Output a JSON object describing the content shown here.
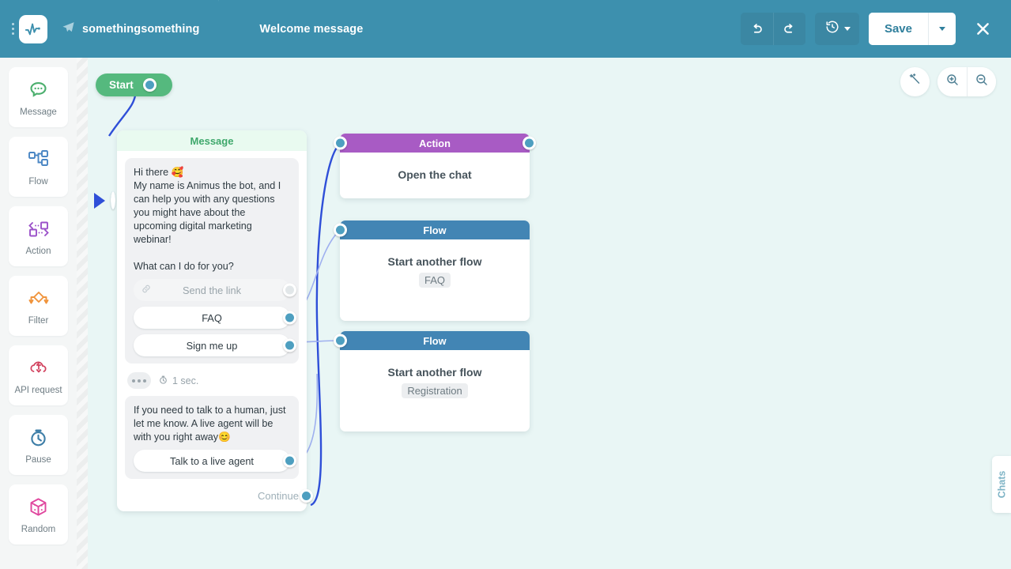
{
  "header": {
    "menu_icon": "kebab-menu-icon",
    "logo_icon": "pulse-logo-icon",
    "breadcrumb": {
      "channel_icon": "telegram-plane-icon",
      "account": "somethingsomething",
      "flow": "Welcome message"
    },
    "undo_icon": "undo-arrow-icon",
    "redo_icon": "redo-arrow-icon",
    "history_icon": "history-clock-icon",
    "save_label": "Save",
    "save_caret_icon": "chevron-down-icon",
    "close_icon": "close-x-icon",
    "bg_color": "#3d90ae"
  },
  "sidebar": {
    "items": [
      {
        "label": "Message",
        "icon": "chat-bubble-icon",
        "color": "#4caf6e"
      },
      {
        "label": "Flow",
        "icon": "flow-tree-icon",
        "color": "#4a86c4"
      },
      {
        "label": "Action",
        "icon": "action-swap-icon",
        "color": "#9b51c9"
      },
      {
        "label": "Filter",
        "icon": "filter-diamond-icon",
        "color": "#f0943c"
      },
      {
        "label": "API request",
        "icon": "api-cloud-icon",
        "color": "#d2435f"
      },
      {
        "label": "Pause",
        "icon": "stopwatch-icon",
        "color": "#3f7fa8"
      },
      {
        "label": "Random",
        "icon": "dice-cube-icon",
        "color": "#e0479e"
      }
    ]
  },
  "canvas": {
    "bg_color": "#e9f6f5",
    "controls": [
      {
        "icon": "magic-wand-icon",
        "name": "auto-arrange-button"
      },
      {
        "icon": "zoom-in-icon",
        "name": "zoom-in-button"
      },
      {
        "icon": "zoom-out-icon",
        "name": "zoom-out-button"
      }
    ],
    "chats_tab_label": "Chats",
    "start": {
      "label": "Start"
    },
    "message_node": {
      "header": "Message",
      "text_line_1": "Hi there 🥰",
      "text_line_2": "My name is Animus the bot, and I can help you with any questions you might have about the upcoming digital marketing webinar!",
      "text_line_3": "What can I do for you?",
      "options": [
        {
          "label": "Send the link",
          "icon": "link-chain-icon",
          "state": "muted"
        },
        {
          "label": "FAQ",
          "state": "connected"
        },
        {
          "label": "Sign me up",
          "state": "connected"
        }
      ],
      "delay": "1 sec.",
      "delay_icon": "stopwatch-small-icon",
      "text_line_4": "If you need to talk to a human, just let me know. A live agent will be with you right away😊",
      "options_2": [
        {
          "label": "Talk to a live agent",
          "state": "connected"
        }
      ],
      "continue_label": "Continue"
    },
    "nodes": [
      {
        "type": "Action",
        "title": "Open the chat",
        "chip": "",
        "color": "#a85bc4"
      },
      {
        "type": "Flow",
        "title": "Start another flow",
        "chip": "FAQ",
        "color": "#4285b4"
      },
      {
        "type": "Flow",
        "title": "Start another flow",
        "chip": "Registration",
        "color": "#4285b4"
      }
    ]
  }
}
